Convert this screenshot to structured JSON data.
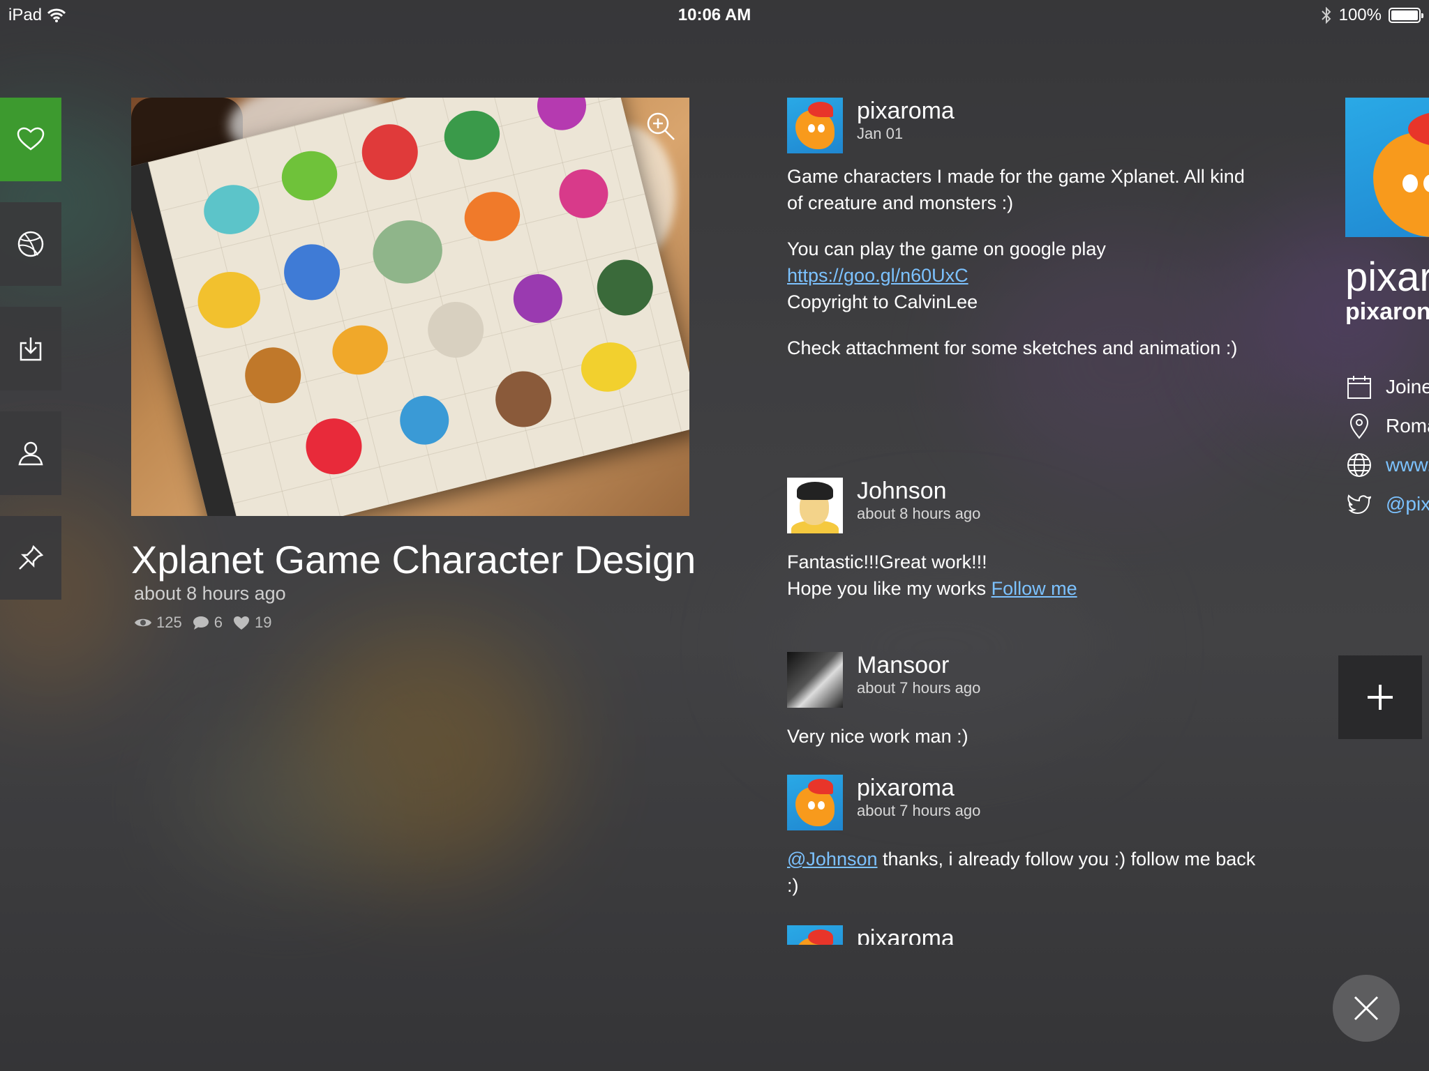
{
  "status_bar": {
    "device": "iPad",
    "time": "10:06 AM",
    "battery": "100%",
    "battery_level": 1.0
  },
  "sidebar": {
    "items": [
      {
        "icon": "heart-icon",
        "active": true
      },
      {
        "icon": "globe-icon",
        "active": false
      },
      {
        "icon": "download-icon",
        "active": false
      },
      {
        "icon": "user-icon",
        "active": false
      },
      {
        "icon": "pin-icon",
        "active": false
      }
    ]
  },
  "shot": {
    "title": "Xplanet Game Character Design",
    "time": "about 8 hours ago",
    "views": "125",
    "comments": "6",
    "likes": "19"
  },
  "comments": [
    {
      "author": "pixaroma",
      "when": "Jan 01",
      "paragraphs": [
        "Game characters I made for the game Xplanet. All kind of creature and monsters :)",
        "You can play the game on google play",
        "https://goo.gl/n60UxC",
        "Copyright to CalvinLee",
        "Check attachment for some sketches and animation :)"
      ]
    },
    {
      "author": "Johnson",
      "when": "about 8 hours ago",
      "line1": "Fantastic!!!Great work!!!",
      "line2": "Hope you like my works ",
      "link": "Follow me"
    },
    {
      "author": "Mansoor",
      "when": "about 7 hours ago",
      "line1": "Very nice work man :)"
    },
    {
      "author": "pixaroma",
      "when": "about 7 hours ago",
      "mention": "@Johnson",
      "text": " thanks, i already follow you :) follow me back :)"
    },
    {
      "author": "pixaroma"
    }
  ],
  "profile": {
    "name": "pixarc",
    "username": "pixaron",
    "joined": "Joinec",
    "location": "Roma",
    "website": "www.",
    "twitter": "@pix"
  },
  "colors": {
    "accent_green": "#3d9a2f",
    "link_blue": "#7cc2ff"
  }
}
